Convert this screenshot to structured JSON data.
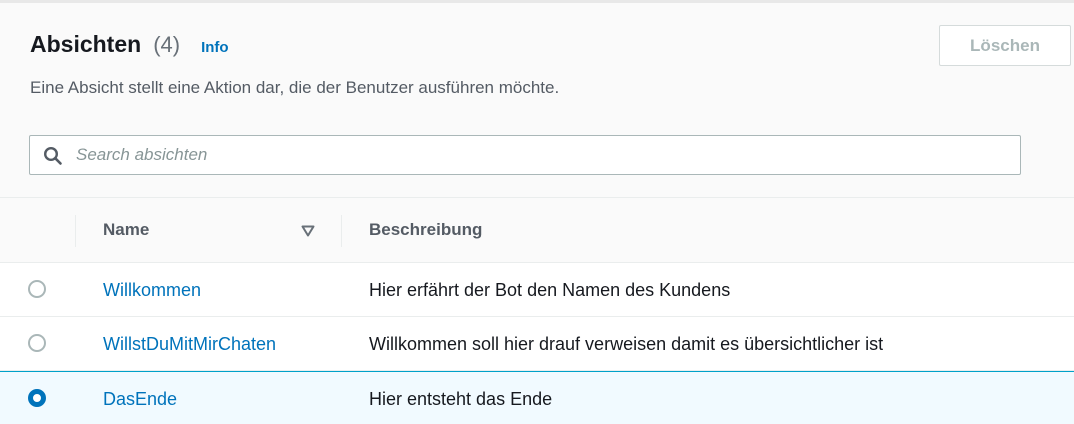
{
  "header": {
    "title": "Absichten",
    "count": "(4)",
    "info_label": "Info",
    "delete_label": "Löschen",
    "description": "Eine Absicht stellt eine Aktion dar, die der Benutzer ausführen möchte."
  },
  "search": {
    "placeholder": "Search absichten",
    "icon": "search-icon"
  },
  "table": {
    "columns": [
      "Name",
      "Beschreibung"
    ],
    "rows": [
      {
        "name": "Willkommen",
        "description": "Hier erfährt der Bot den Namen des Kundens",
        "selected": false
      },
      {
        "name": "WillstDuMitMirChaten",
        "description": "Willkommen soll hier drauf verweisen damit es übersichtlicher ist",
        "selected": false
      },
      {
        "name": "DasEnde",
        "description": "Hier entsteht das Ende",
        "selected": true
      }
    ]
  },
  "colors": {
    "link": "#0073bb",
    "selected_row_bg": "#f1faff",
    "selected_row_border": "#00a1c9"
  }
}
